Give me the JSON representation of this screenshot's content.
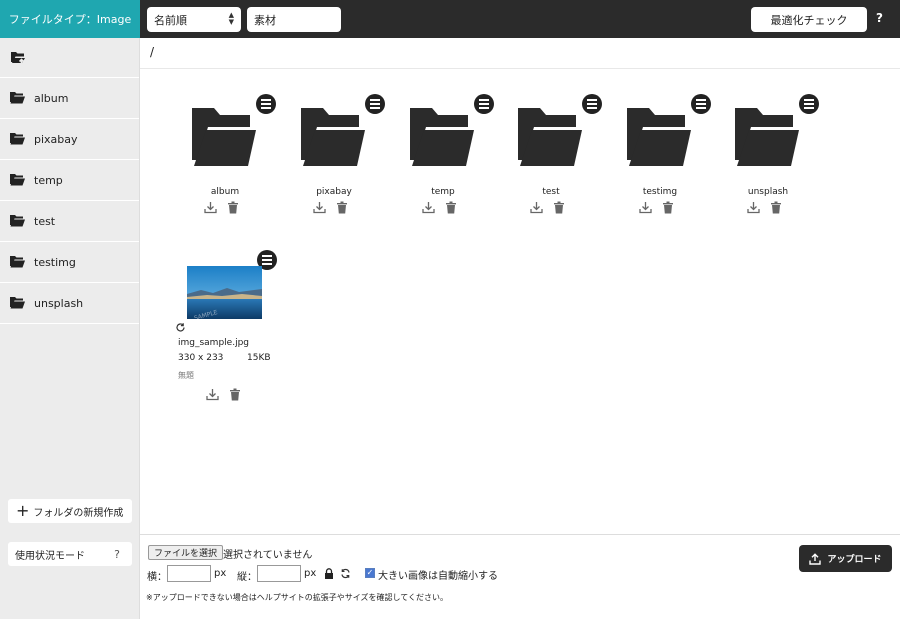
{
  "topbar": {
    "filetype_label": "ファイルタイプ：Image",
    "sort_value": "名前順",
    "search_value": "素材",
    "optimize_label": "最適化チェック",
    "help_label": "?"
  },
  "sidebar": {
    "items": [
      {
        "label": "album"
      },
      {
        "label": "pixabay"
      },
      {
        "label": "temp"
      },
      {
        "label": "test"
      },
      {
        "label": "testimg"
      },
      {
        "label": "unsplash"
      }
    ],
    "new_folder_label": "フォルダの新規作成",
    "usage_label": "使用状況モード",
    "usage_help": "?"
  },
  "main": {
    "path": "/",
    "folders": [
      {
        "name": "album"
      },
      {
        "name": "pixabay"
      },
      {
        "name": "temp"
      },
      {
        "name": "test"
      },
      {
        "name": "testimg"
      },
      {
        "name": "unsplash"
      }
    ],
    "image": {
      "filename": "img_sample.jpg",
      "dimensions": "330 x 233",
      "filesize": "15KB",
      "title": "無題"
    }
  },
  "footer": {
    "choose_file_label": "ファイルを選択",
    "no_file_text": "選択されていません",
    "width_label": "横：",
    "height_label": "縦：",
    "px_label": "px",
    "auto_resize_label": "大きい画像は自動縮小する",
    "auto_resize_checked": true,
    "note": "※アップロードできない場合はヘルプサイトの拡張子やサイズを確認してください。",
    "upload_label": "アップロード"
  },
  "colors": {
    "accent": "#1fa7b0",
    "topbar": "#2b2b2b",
    "sidebar": "#ececec"
  }
}
